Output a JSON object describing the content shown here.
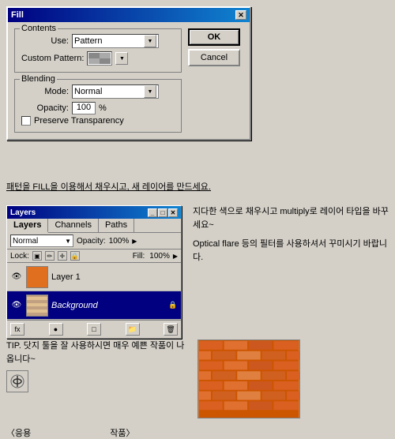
{
  "fillDialog": {
    "title": "Fill",
    "contents": {
      "label": "Contents",
      "useLabel": "Use:",
      "useValue": "Pattern",
      "customPatternLabel": "Custom Pattern:"
    },
    "blending": {
      "label": "Blending",
      "modeLabel": "Mode:",
      "modeValue": "Normal",
      "opacityLabel": "Opacity:",
      "opacityValue": "100",
      "opacityUnit": "%",
      "preserveLabel": "Preserve Transparency"
    },
    "buttons": {
      "ok": "OK",
      "cancel": "Cancel"
    },
    "close": "✕"
  },
  "instructionText": "패턴을 FILL을 이용해서 채우시고, 새 레이어를 만드세요.",
  "layersPanel": {
    "title": "Layers",
    "titleButtons": [
      "_",
      "□",
      "✕"
    ],
    "tabs": [
      "Layers",
      "Channels",
      "Paths"
    ],
    "activeTab": "Layers",
    "modeLabel": "Normal",
    "opacityLabel": "Opacity:",
    "opacityValue": "100%",
    "lockLabel": "Lock:",
    "fillLabel": "Fill:",
    "fillValue": "100%",
    "layers": [
      {
        "name": "Layer 1",
        "visible": true,
        "type": "orange",
        "italic": false
      },
      {
        "name": "Background",
        "visible": true,
        "type": "bg",
        "italic": true,
        "locked": true
      }
    ],
    "bottomButtons": [
      "fx",
      "●",
      "□",
      "✕",
      "🗑"
    ]
  },
  "rightText1": "지다한 색으로 채우시고 multiply로 레이어 타입을 바꾸세요~",
  "rightText2": "Optical flare 등의 필터를 사용하셔서 꾸미시기 바랍니다.",
  "tipText": "TIP. 닷지 툴을 잘 사용하시면 매우 예쁜 작품이 나옵니다~",
  "bottomLabels": {
    "left": "〈응용",
    "right": "작품〉"
  },
  "icons": {
    "close": "✕",
    "minimize": "_",
    "maximize": "□",
    "arrow": "▼",
    "eye": "👁",
    "lock": "🔒"
  }
}
